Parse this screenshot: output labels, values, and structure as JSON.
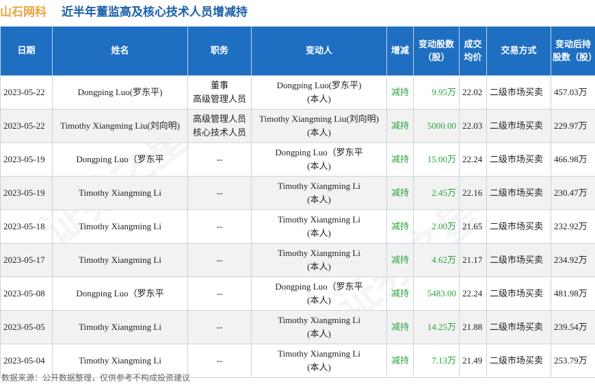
{
  "title": {
    "brand": "山石网科",
    "heading": "近半年董监高及核心技术人员增减持"
  },
  "table": {
    "headers": {
      "date": "日期",
      "name": "姓名",
      "position": "职务",
      "changer": "变动人",
      "direction": "增减",
      "shares_changed": "变动股数（股）",
      "avg_price": "成交均价",
      "trade_type": "交易方式",
      "shares_after": "变动后持股数（股）"
    },
    "rows": [
      {
        "date": "2023-05-22",
        "name": "Dongping Luo(罗东平)",
        "position_1": "董事",
        "position_2": "高级管理人员",
        "changer_1": "Dongping Luo(罗东平)",
        "changer_2": "(本人)",
        "direction": "减持",
        "shares_changed": "9.95万",
        "avg_price": "22.02",
        "trade_type": "二级市场买卖",
        "shares_after": "457.03万"
      },
      {
        "date": "2023-05-22",
        "name": "Timothy Xiangming Liu(刘向明)",
        "position_1": "高级管理人员",
        "position_2": "核心技术人员",
        "changer_1": "Timothy Xiangming Liu(刘向明)",
        "changer_2": "(本人)",
        "direction": "减持",
        "shares_changed": "5000.00",
        "avg_price": "22.03",
        "trade_type": "二级市场买卖",
        "shares_after": "229.97万"
      },
      {
        "date": "2023-05-19",
        "name": "Dongping Luo（罗东平",
        "position_1": "--",
        "position_2": "",
        "changer_1": "Dongping Luo（罗东平",
        "changer_2": "(本人)",
        "direction": "减持",
        "shares_changed": "15.00万",
        "avg_price": "22.24",
        "trade_type": "二级市场买卖",
        "shares_after": "466.98万"
      },
      {
        "date": "2023-05-19",
        "name": "Timothy Xiangming Li",
        "position_1": "--",
        "position_2": "",
        "changer_1": "Timothy Xiangming Li",
        "changer_2": "(本人)",
        "direction": "减持",
        "shares_changed": "2.45万",
        "avg_price": "22.16",
        "trade_type": "二级市场买卖",
        "shares_after": "230.47万"
      },
      {
        "date": "2023-05-18",
        "name": "Timothy Xiangming Li",
        "position_1": "--",
        "position_2": "",
        "changer_1": "Timothy Xiangming Li",
        "changer_2": "(本人)",
        "direction": "减持",
        "shares_changed": "2.00万",
        "avg_price": "21.65",
        "trade_type": "二级市场买卖",
        "shares_after": "232.92万"
      },
      {
        "date": "2023-05-17",
        "name": "Timothy Xiangming Li",
        "position_1": "--",
        "position_2": "",
        "changer_1": "Timothy Xiangming Li",
        "changer_2": "(本人)",
        "direction": "减持",
        "shares_changed": "4.62万",
        "avg_price": "21.17",
        "trade_type": "二级市场买卖",
        "shares_after": "234.92万"
      },
      {
        "date": "2023-05-08",
        "name": "Dongping Luo（罗东平",
        "position_1": "--",
        "position_2": "",
        "changer_1": "Dongping Luo（罗东平",
        "changer_2": "(本人)",
        "direction": "减持",
        "shares_changed": "5483.00",
        "avg_price": "22.24",
        "trade_type": "二级市场买卖",
        "shares_after": "481.98万"
      },
      {
        "date": "2023-05-05",
        "name": "Timothy Xiangming Li",
        "position_1": "--",
        "position_2": "",
        "changer_1": "Timothy Xiangming Li",
        "changer_2": "(本人)",
        "direction": "减持",
        "shares_changed": "14.25万",
        "avg_price": "21.88",
        "trade_type": "二级市场买卖",
        "shares_after": "239.54万"
      },
      {
        "date": "2023-05-04",
        "name": "Timothy Xiangming Li",
        "position_1": "--",
        "position_2": "",
        "changer_1": "Timothy Xiangming Li",
        "changer_2": "(本人)",
        "direction": "减持",
        "shares_changed": "7.13万",
        "avg_price": "21.49",
        "trade_type": "二级市场买卖",
        "shares_after": "253.79万"
      }
    ]
  },
  "footer": {
    "source": "数据来源：公开数据整理，仅供参考不构成投资建议"
  },
  "watermark": "证券之星",
  "colors": {
    "brand": "#e8a43c",
    "heading": "#1a5fa8",
    "header_bg": "#1e6ec2",
    "direction_text": "#2aa23c",
    "stripe": "#f2f2f2"
  }
}
